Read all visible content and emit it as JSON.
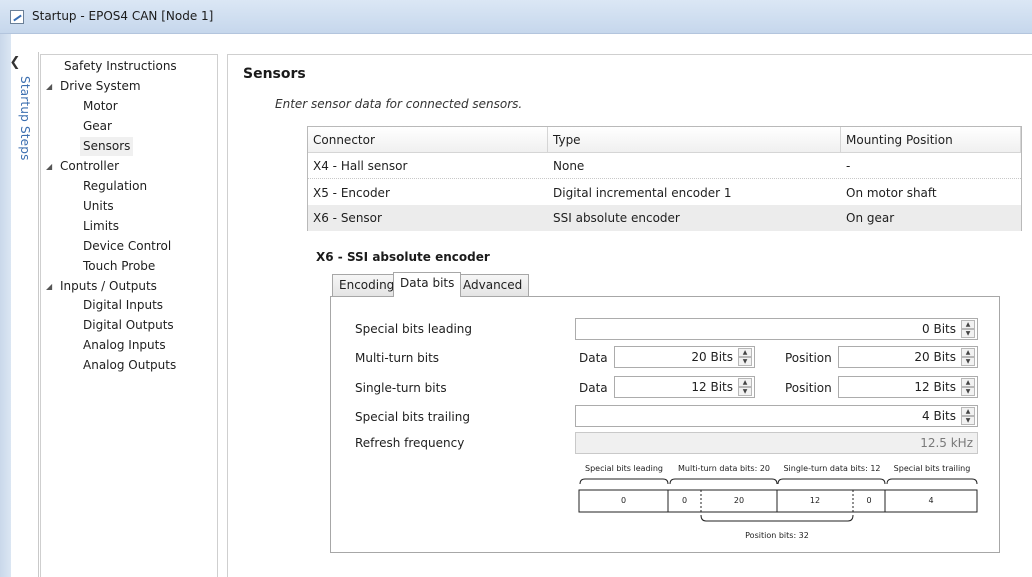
{
  "window": {
    "title": "Startup - EPOS4 CAN [Node 1]"
  },
  "rail": {
    "label": "Startup Steps"
  },
  "tree": {
    "items": [
      {
        "label": "Safety Instructions"
      },
      {
        "label": "Drive System"
      },
      {
        "label": "Motor"
      },
      {
        "label": "Gear"
      },
      {
        "label": "Sensors"
      },
      {
        "label": "Controller"
      },
      {
        "label": "Regulation"
      },
      {
        "label": "Units"
      },
      {
        "label": "Limits"
      },
      {
        "label": "Device Control"
      },
      {
        "label": "Touch Probe"
      },
      {
        "label": "Inputs / Outputs"
      },
      {
        "label": "Digital Inputs"
      },
      {
        "label": "Digital Outputs"
      },
      {
        "label": "Analog Inputs"
      },
      {
        "label": "Analog Outputs"
      }
    ]
  },
  "page": {
    "title": "Sensors",
    "description": "Enter sensor data for connected sensors."
  },
  "sensor_table": {
    "columns": [
      "Connector",
      "Type",
      "Mounting Position"
    ],
    "rows": [
      {
        "connector": "X4 - Hall sensor",
        "type": "None",
        "mounting": "-"
      },
      {
        "connector": "X5 - Encoder",
        "type": "Digital incremental encoder 1",
        "mounting": "On motor shaft"
      },
      {
        "connector": "X6 - Sensor",
        "type": "SSI absolute encoder",
        "mounting": "On gear"
      }
    ]
  },
  "group": {
    "title": "X6 - SSI absolute encoder",
    "tabs": [
      {
        "label": "Encoding"
      },
      {
        "label": "Data bits"
      },
      {
        "label": "Advanced"
      }
    ]
  },
  "fields": {
    "special_leading": {
      "label": "Special bits leading",
      "value": "0 Bits"
    },
    "multi_turn": {
      "label": "Multi-turn bits",
      "data_label": "Data",
      "data_value": "20 Bits",
      "position_label": "Position",
      "position_value": "20 Bits"
    },
    "single_turn": {
      "label": "Single-turn bits",
      "data_label": "Data",
      "data_value": "12 Bits",
      "position_label": "Position",
      "position_value": "12 Bits"
    },
    "special_trailing": {
      "label": "Special bits trailing",
      "value": "4 Bits"
    },
    "refresh": {
      "label": "Refresh frequency",
      "value": "12.5 kHz"
    }
  },
  "bit_diagram": {
    "top_labels": {
      "leading": "Special bits leading",
      "multi": "Multi-turn data bits: 20",
      "single": "Single-turn data bits: 12",
      "trailing": "Special bits trailing"
    },
    "cells": [
      "0",
      "0",
      "20",
      "12",
      "0",
      "4"
    ],
    "bottom_label": "Position bits: 32"
  }
}
